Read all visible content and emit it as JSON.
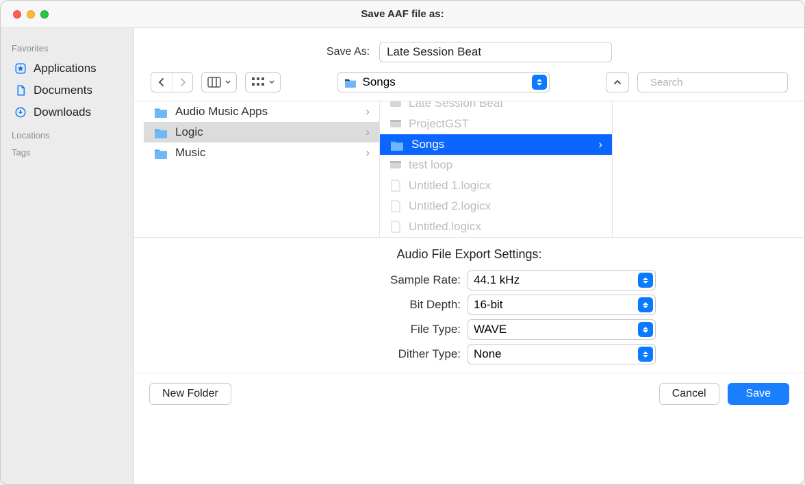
{
  "window": {
    "title": "Save AAF file as:"
  },
  "saveas": {
    "label": "Save As:",
    "value": "Late Session Beat"
  },
  "toolbar": {
    "location_label": "Songs",
    "search_placeholder": "Search"
  },
  "sidebar": {
    "sections": {
      "favorites": "Favorites",
      "locations": "Locations",
      "tags": "Tags"
    },
    "favorites": [
      {
        "label": "Applications"
      },
      {
        "label": "Documents"
      },
      {
        "label": "Downloads"
      }
    ]
  },
  "columns": {
    "col1": [
      {
        "label": "Audio Music Apps",
        "type": "folder"
      },
      {
        "label": "Logic",
        "type": "folder",
        "selected": "grey"
      },
      {
        "label": "Music",
        "type": "folder"
      }
    ],
    "col2": [
      {
        "label": "Late Session Beat",
        "type": "doc-grey",
        "muted": true,
        "cut": true
      },
      {
        "label": "ProjectGST",
        "type": "doc-grey",
        "muted": true
      },
      {
        "label": "Songs",
        "type": "folder",
        "selected": "blue"
      },
      {
        "label": "test loop",
        "type": "doc-grey",
        "muted": true
      },
      {
        "label": "Untitled 1.logicx",
        "type": "doc-white",
        "muted": true
      },
      {
        "label": "Untitled 2.logicx",
        "type": "doc-white",
        "muted": true
      },
      {
        "label": "Untitled.logicx",
        "type": "doc-white",
        "muted": true,
        "cutbottom": true
      }
    ]
  },
  "export": {
    "title": "Audio File Export Settings:",
    "rows": [
      {
        "label": "Sample Rate:",
        "value": "44.1 kHz"
      },
      {
        "label": "Bit Depth:",
        "value": "16-bit"
      },
      {
        "label": "File Type:",
        "value": "WAVE"
      },
      {
        "label": "Dither Type:",
        "value": "None"
      }
    ]
  },
  "footer": {
    "new_folder": "New Folder",
    "cancel": "Cancel",
    "save": "Save"
  }
}
